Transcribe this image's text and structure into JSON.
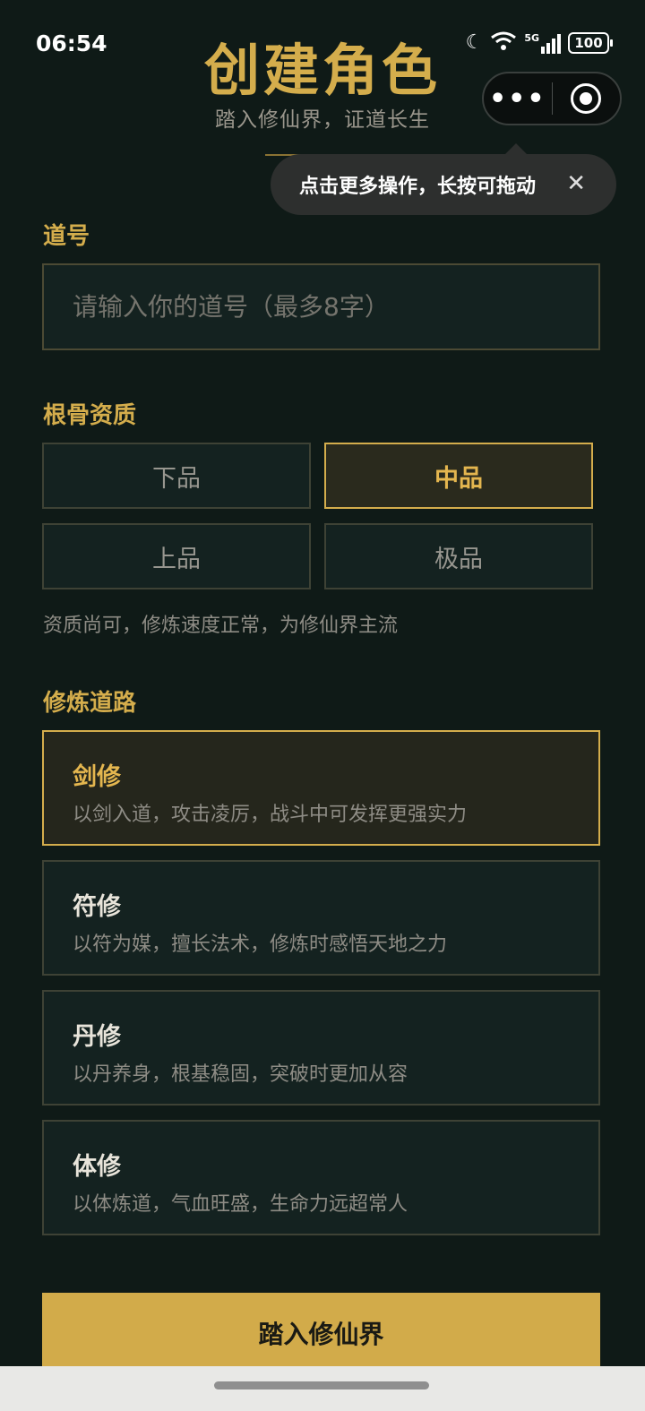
{
  "status_bar": {
    "time": "06:54",
    "signal_label": "5G",
    "battery": "100"
  },
  "header": {
    "title": "创建角色",
    "subtitle": "踏入修仙界，证道长生"
  },
  "capsule": {
    "more_icon": "more-dots-icon",
    "close_icon": "target-icon"
  },
  "tooltip": {
    "text": "点击更多操作，长按可拖动",
    "close": "✕"
  },
  "name_section": {
    "label": "道号",
    "placeholder": "请输入你的道号（最多8字）",
    "value": ""
  },
  "grade_section": {
    "label": "根骨资质",
    "options": [
      {
        "label": "下品",
        "selected": false
      },
      {
        "label": "中品",
        "selected": true
      },
      {
        "label": "上品",
        "selected": false
      },
      {
        "label": "极品",
        "selected": false
      }
    ],
    "description": "资质尚可，修炼速度正常，为修仙界主流"
  },
  "path_section": {
    "label": "修炼道路",
    "options": [
      {
        "name": "剑修",
        "desc": "以剑入道，攻击凌厉，战斗中可发挥更强实力",
        "selected": true
      },
      {
        "name": "符修",
        "desc": "以符为媒，擅长法术，修炼时感悟天地之力",
        "selected": false
      },
      {
        "name": "丹修",
        "desc": "以丹养身，根基稳固，突破时更加从容",
        "selected": false
      },
      {
        "name": "体修",
        "desc": "以体炼道，气血旺盛，生命力远超常人",
        "selected": false
      }
    ]
  },
  "submit": {
    "label": "踏入修仙界"
  },
  "colors": {
    "background": "#0f1a17",
    "accent_gold": "#d4ad4c",
    "card": "#142220",
    "button": "#d2ab4a"
  }
}
